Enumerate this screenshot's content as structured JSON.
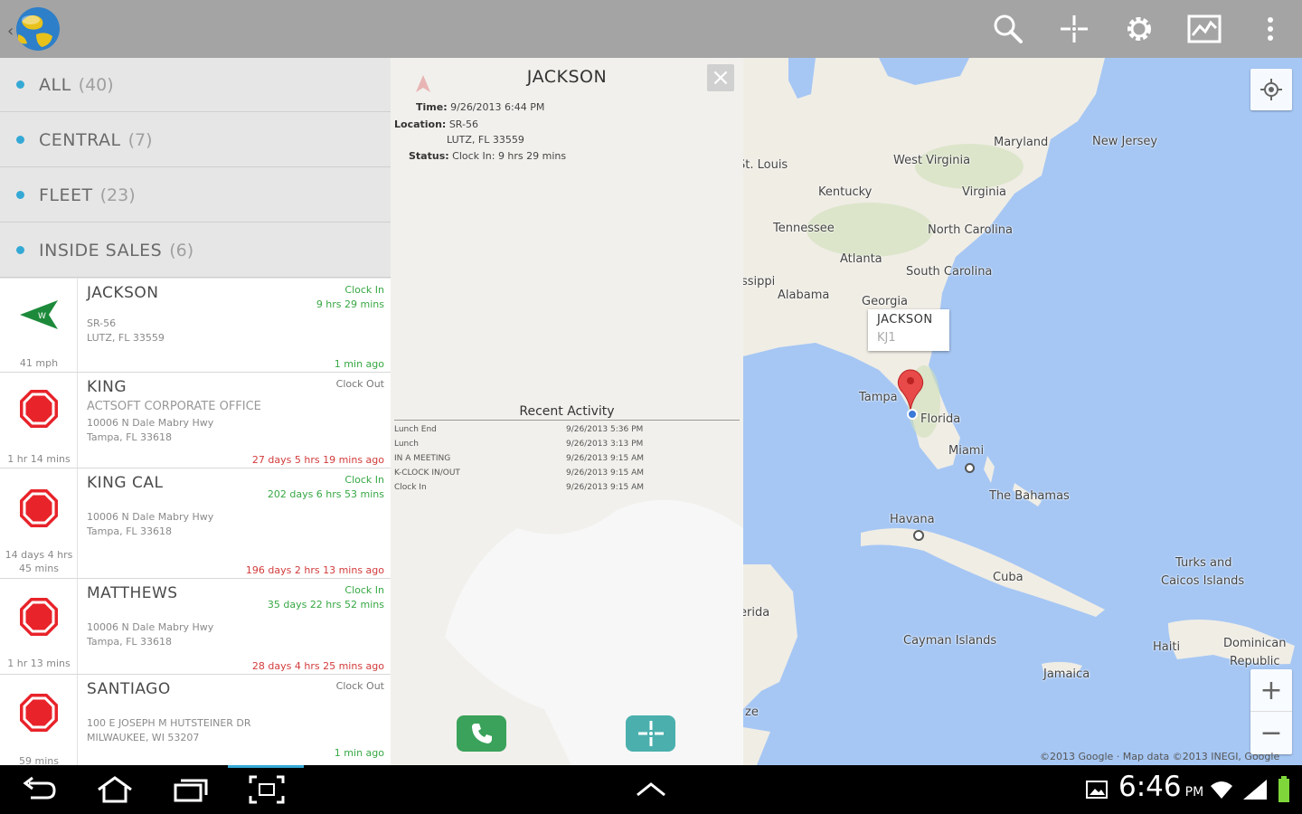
{
  "groups": [
    {
      "label": "ALL",
      "count": "(40)"
    },
    {
      "label": "CENTRAL",
      "count": "(7)"
    },
    {
      "label": "FLEET",
      "count": "(23)"
    },
    {
      "label": "INSIDE SALES",
      "count": "(6)"
    }
  ],
  "employees": [
    {
      "name": "JACKSON",
      "icon": "navigation-arrow-icon",
      "addr1": "SR-56",
      "addr2": "LUTZ, FL 33559",
      "status1": "Clock In",
      "status2": "9 hrs 29 mins",
      "ago": "1 min ago",
      "under1": "41 mph",
      "under2": ""
    },
    {
      "name": "KING",
      "icon": "stop-sign-icon",
      "company": "ACTSOFT CORPORATE OFFICE",
      "addr1": "10006 N Dale Mabry Hwy",
      "addr2": "Tampa, FL 33618",
      "status1": "Clock Out",
      "status2": "",
      "ago": "27 days 5 hrs 19 mins ago",
      "under1": "1 hr 14 mins",
      "under2": ""
    },
    {
      "name": "KING CAL",
      "icon": "stop-sign-icon",
      "addr1": "10006 N Dale Mabry Hwy",
      "addr2": "Tampa, FL 33618",
      "status1": "Clock In",
      "status2": "202 days 6 hrs 53 mins",
      "ago": "196 days 2 hrs 13 mins ago",
      "under1": "14 days 4 hrs",
      "under2": "45 mins"
    },
    {
      "name": "MATTHEWS",
      "icon": "stop-sign-icon",
      "addr1": "10006 N Dale Mabry Hwy",
      "addr2": "Tampa, FL 33618",
      "status1": "Clock In",
      "status2": "35 days 22 hrs 52 mins",
      "ago": "28 days 4 hrs 25 mins ago",
      "under1": "1 hr 13 mins",
      "under2": ""
    },
    {
      "name": "SANTIAGO",
      "icon": "stop-sign-icon",
      "addr1": "100 E JOSEPH M HUTSTEINER DR",
      "addr2": "MILWAUKEE, WI 53207",
      "status1": "Clock Out",
      "status2": "",
      "ago": "1 min ago",
      "under1": "59 mins",
      "under2": ""
    }
  ],
  "detail": {
    "title": "JACKSON",
    "time_label": "Time:",
    "time_value": "9/26/2013 6:44 PM",
    "location_label": "Location:",
    "location_value1": "SR-56",
    "location_value2": "LUTZ, FL 33559",
    "status_label": "Status:",
    "status_value": "Clock In: 9 hrs 29 mins",
    "recent_title": "Recent Activity",
    "activities": [
      {
        "type": "Lunch End",
        "time": "9/26/2013 5:36 PM"
      },
      {
        "type": "Lunch",
        "time": "9/26/2013 3:13 PM"
      },
      {
        "type": "IN A MEETING",
        "time": "9/26/2013 9:15 AM"
      },
      {
        "type": "K-CLOCK IN/OUT",
        "time": "9/26/2013 9:15 AM"
      },
      {
        "type": "Clock In",
        "time": "9/26/2013 9:15 AM"
      }
    ]
  },
  "map": {
    "labels": [
      "Maryland",
      "New Jersey",
      "West Virginia",
      "St. Louis",
      "Kentucky",
      "Virginia",
      "Tennessee",
      "North Carolina",
      "Atlanta",
      "South Carolina",
      "Alabama",
      "Georgia",
      "Tampa",
      "Florida",
      "Miami",
      "The Bahamas",
      "Havana",
      "Cuba",
      "Turks and",
      "Caicos Islands",
      "Cayman Islands",
      "Haiti",
      "Dominican",
      "Republic",
      "Jamaica",
      "erida",
      "ze",
      "ssippi"
    ],
    "marker_title": "JACKSON",
    "marker_sub": "KJ1",
    "attribution": "©2013 Google · Map data ©2013 INEGI, Google"
  },
  "status_bar": {
    "time": "6:46",
    "ampm": "PM"
  },
  "colors": {
    "accent": "#35a9d6",
    "green": "#37a744",
    "red": "#d33b3b",
    "stop": "#e8232a",
    "water": "#a6c7f4",
    "land": "#f0ede5"
  }
}
